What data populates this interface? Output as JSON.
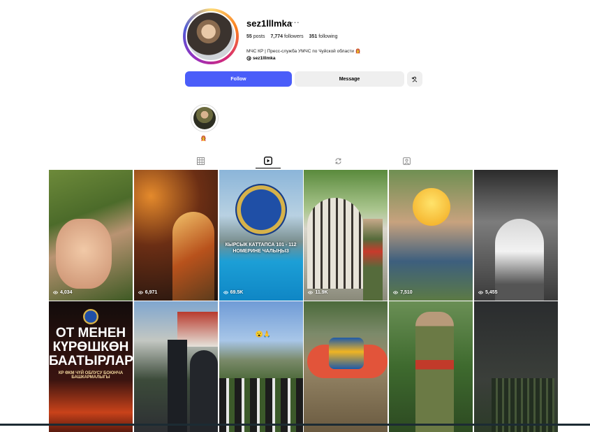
{
  "profile": {
    "username": "sez1lllmka",
    "more": "···",
    "posts": "55",
    "posts_label": "posts",
    "followers": "7,774",
    "followers_label": "followers",
    "following": "351",
    "following_label": "following",
    "bio": "МЧС КР | Пресс-служба УМЧС по Чуйской области 👩‍🚒",
    "threads_handle": "sez1lllmka"
  },
  "actions": {
    "follow": "Follow",
    "message": "Message",
    "add_person": "+👤"
  },
  "highlights": [
    {
      "label": "👩‍🚒"
    }
  ],
  "tabs": [
    {
      "name": "posts",
      "icon": "grid-icon"
    },
    {
      "name": "reels",
      "icon": "reels-icon",
      "active": true
    },
    {
      "name": "reposts",
      "icon": "repost-icon"
    },
    {
      "name": "tagged",
      "icon": "tagged-icon"
    }
  ],
  "grid": [
    {
      "views": "4,034"
    },
    {
      "views": "6,971"
    },
    {
      "views": "69.5K",
      "caption": "КЫРСЫК КАТТАПСА 101 - 112 НОМЕРИНЕ ЧАЛЫҢЫЗ"
    },
    {
      "views": "11.9K"
    },
    {
      "views": "7,510"
    },
    {
      "views": "5,455"
    },
    {
      "poster": "ОТ МЕНЕН КҮРӨШКӨН БААТЫРЛАР",
      "poster_sub": "КР ӨКМ ЧҮЙ ОБЛУСУ БОЮНЧА БАШКАРМАЛЫГЫ",
      "views": ""
    },
    {
      "views": ""
    },
    {
      "overlay": "😮🙏",
      "views": ""
    },
    {
      "views": ""
    },
    {
      "views": ""
    },
    {
      "views": ""
    }
  ],
  "colors": {
    "follow_bg": "#4a5df9",
    "secondary_bg": "#efefef"
  }
}
